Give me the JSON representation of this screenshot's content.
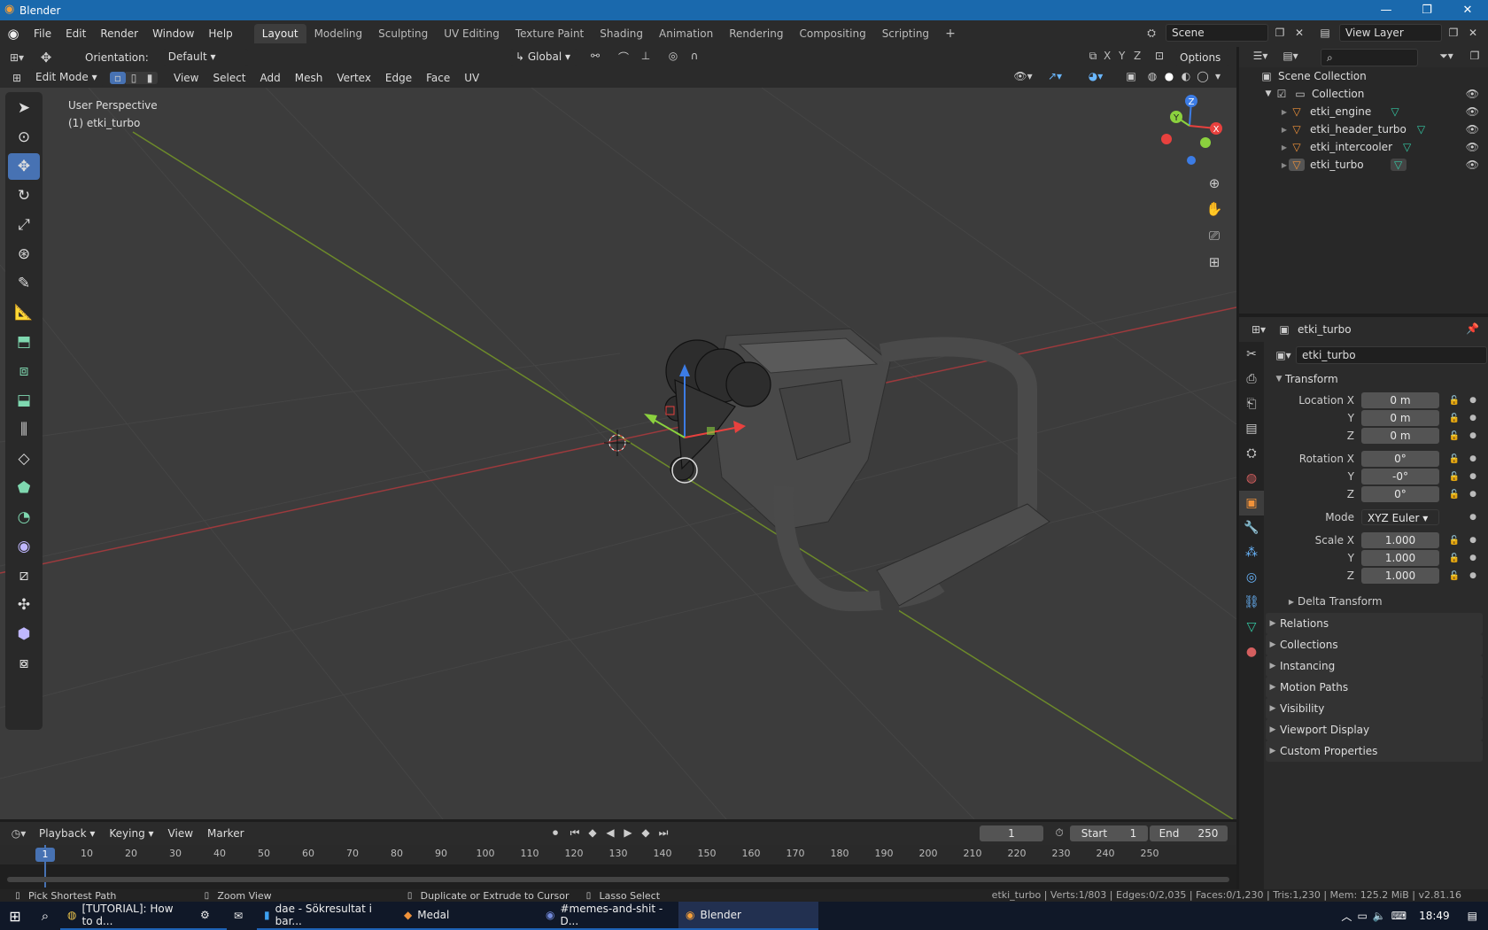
{
  "window": {
    "title": "Blender"
  },
  "menus": [
    "File",
    "Edit",
    "Render",
    "Window",
    "Help"
  ],
  "workspaces": [
    "Layout",
    "Modeling",
    "Sculpting",
    "UV Editing",
    "Texture Paint",
    "Shading",
    "Animation",
    "Rendering",
    "Compositing",
    "Scripting"
  ],
  "scene": {
    "name": "Scene",
    "view_layer": "View Layer"
  },
  "tool_header": {
    "orientation_label": "Orientation:",
    "orientation_value": "Default",
    "transform": "Global",
    "axes": [
      "X",
      "Y",
      "Z"
    ],
    "options": "Options"
  },
  "viewport_header": {
    "mode": "Edit Mode",
    "menus": [
      "View",
      "Select",
      "Add",
      "Mesh",
      "Vertex",
      "Edge",
      "Face",
      "UV"
    ]
  },
  "viewport": {
    "perspective": "User Perspective",
    "object": "(1) etki_turbo",
    "gizmo_axes": [
      "X",
      "Y",
      "Z"
    ]
  },
  "outliner": {
    "root": "Scene Collection",
    "collection": "Collection",
    "objects": [
      "etki_engine",
      "etki_header_turbo",
      "etki_intercooler",
      "etki_turbo"
    ]
  },
  "properties": {
    "object_name": "etki_turbo",
    "data_name": "etki_turbo",
    "transform_title": "Transform",
    "location": {
      "label": "Location X",
      "x": "0 m",
      "y": "0 m",
      "z": "0 m"
    },
    "rotation": {
      "label": "Rotation X",
      "x": "0°",
      "y": "-0°",
      "z": "0°"
    },
    "mode": {
      "label": "Mode",
      "value": "XYZ Euler"
    },
    "scale": {
      "label": "Scale X",
      "x": "1.000",
      "y": "1.000",
      "z": "1.000"
    },
    "axis_y": "Y",
    "axis_z": "Z",
    "delta": "Delta Transform",
    "panels": [
      "Relations",
      "Collections",
      "Instancing",
      "Motion Paths",
      "Visibility",
      "Viewport Display",
      "Custom Properties"
    ]
  },
  "timeline": {
    "menus": [
      "Playback",
      "Keying",
      "View",
      "Marker"
    ],
    "current_frame": "1",
    "start_label": "Start",
    "start": "1",
    "end_label": "End",
    "end": "250",
    "ticks": [
      "1",
      "10",
      "20",
      "30",
      "40",
      "50",
      "60",
      "70",
      "80",
      "90",
      "100",
      "110",
      "120",
      "130",
      "140",
      "150",
      "160",
      "170",
      "180",
      "190",
      "200",
      "210",
      "220",
      "230",
      "240",
      "250"
    ]
  },
  "status": {
    "pick": "Pick Shortest Path",
    "zoom": "Zoom View",
    "extrude": "Duplicate or Extrude to Cursor",
    "lasso": "Lasso Select",
    "stats": "etki_turbo | Verts:1/803 | Edges:0/2,035 | Faces:0/1,230 | Tris:1,230 | Mem: 125.2 MiB | v2.81.16"
  },
  "taskbar": {
    "items": [
      "[TUTORIAL]: How to d...",
      "",
      "",
      "dae - Sökresultat i bar...",
      "Medal",
      "#memes-and-shit - D...",
      "Blender"
    ],
    "time": "18:49"
  },
  "colors": {
    "accent": "#4772b3",
    "x_axis": "#e8413e",
    "y_axis": "#8bd13e",
    "z_axis": "#3c7ce5",
    "titlebar": "#1a69ad"
  }
}
